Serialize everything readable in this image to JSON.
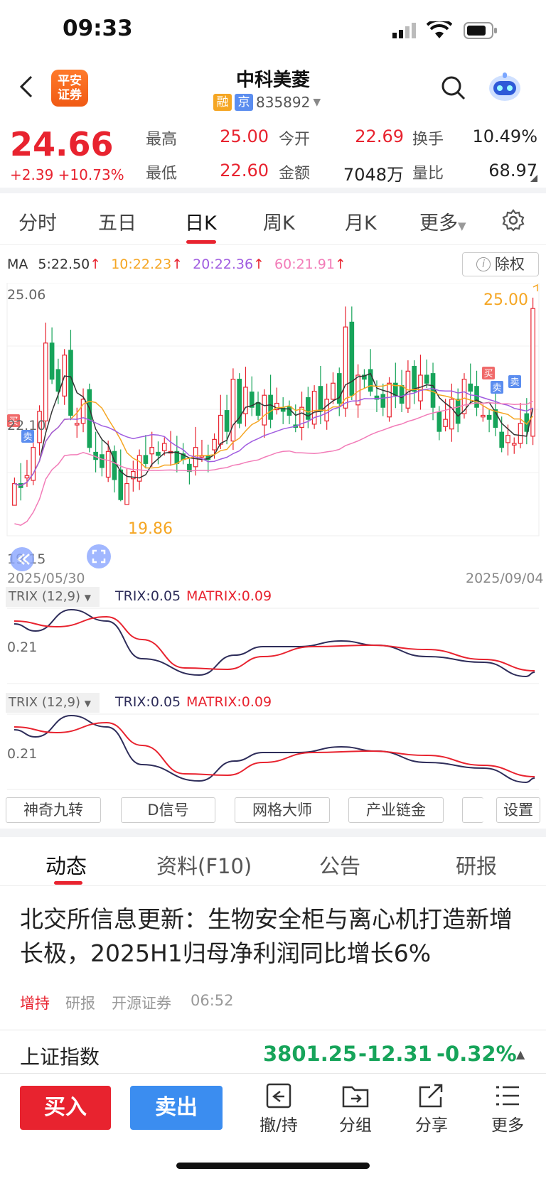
{
  "status": {
    "time": "09:33"
  },
  "header": {
    "logo_text": "平安证券",
    "title": "中科美菱",
    "tag_rong": "融",
    "tag_jing": "京",
    "code": "835892"
  },
  "quote": {
    "price": "24.66",
    "change": "+2.39",
    "change_pct": "+10.73%",
    "items": [
      {
        "label": "最高",
        "value": "25.00"
      },
      {
        "label": "今开",
        "value": "22.69"
      },
      {
        "label": "换手",
        "value": "10.49%"
      },
      {
        "label": "最低",
        "value": "22.60"
      },
      {
        "label": "金额",
        "value": "7048万"
      },
      {
        "label": "量比",
        "value": "68.97"
      }
    ]
  },
  "tabs": [
    "分时",
    "五日",
    "日K",
    "周K",
    "月K",
    "更多"
  ],
  "ma": {
    "label": "MA",
    "ma5": "5:22.50",
    "ma10": "10:22.23",
    "ma20": "20:22.36",
    "ma60": "60:21.91",
    "fq_button": "除权"
  },
  "kchart": {
    "y_top": "25.06",
    "y_mid": "22.10",
    "y_bottom": "19.15",
    "max_label": "25.00",
    "min_label": "19.86",
    "date_start": "2025/05/30",
    "date_end": "2025/09/04",
    "buy_mark": "买",
    "sell_mark": "卖"
  },
  "trix": {
    "selector": "TRIX (12,9)",
    "trix": "TRIX:0.05",
    "matrix": "MATRIX:0.09",
    "y_label": "0.21"
  },
  "indicator_buttons": [
    "神奇九转",
    "D信号",
    "网格大师",
    "产业链金",
    "设置"
  ],
  "news_tabs": [
    "动态",
    "资料(F10)",
    "公告",
    "研报"
  ],
  "news": {
    "headline": "北交所信息更新：生物安全柜与离心机打造新增长极，2025H1归母净利润同比增长6%",
    "rating": "增持",
    "type": "研报",
    "source": "开源证券",
    "time": "06:52"
  },
  "index": {
    "name": "上证指数",
    "value": "3801.25",
    "change": "-12.31",
    "pct": "-0.32%"
  },
  "bottom": {
    "buy": "买入",
    "sell": "卖出",
    "actions": [
      "撤/持",
      "分组",
      "分享",
      "更多"
    ]
  },
  "colors": {
    "up": "#e8232f",
    "down": "#17a45a",
    "ma5": "#333333",
    "ma10": "#f5a623",
    "ma20": "#a05ce0",
    "ma60": "#f27cb8",
    "sell_button": "#3b8df0"
  }
}
